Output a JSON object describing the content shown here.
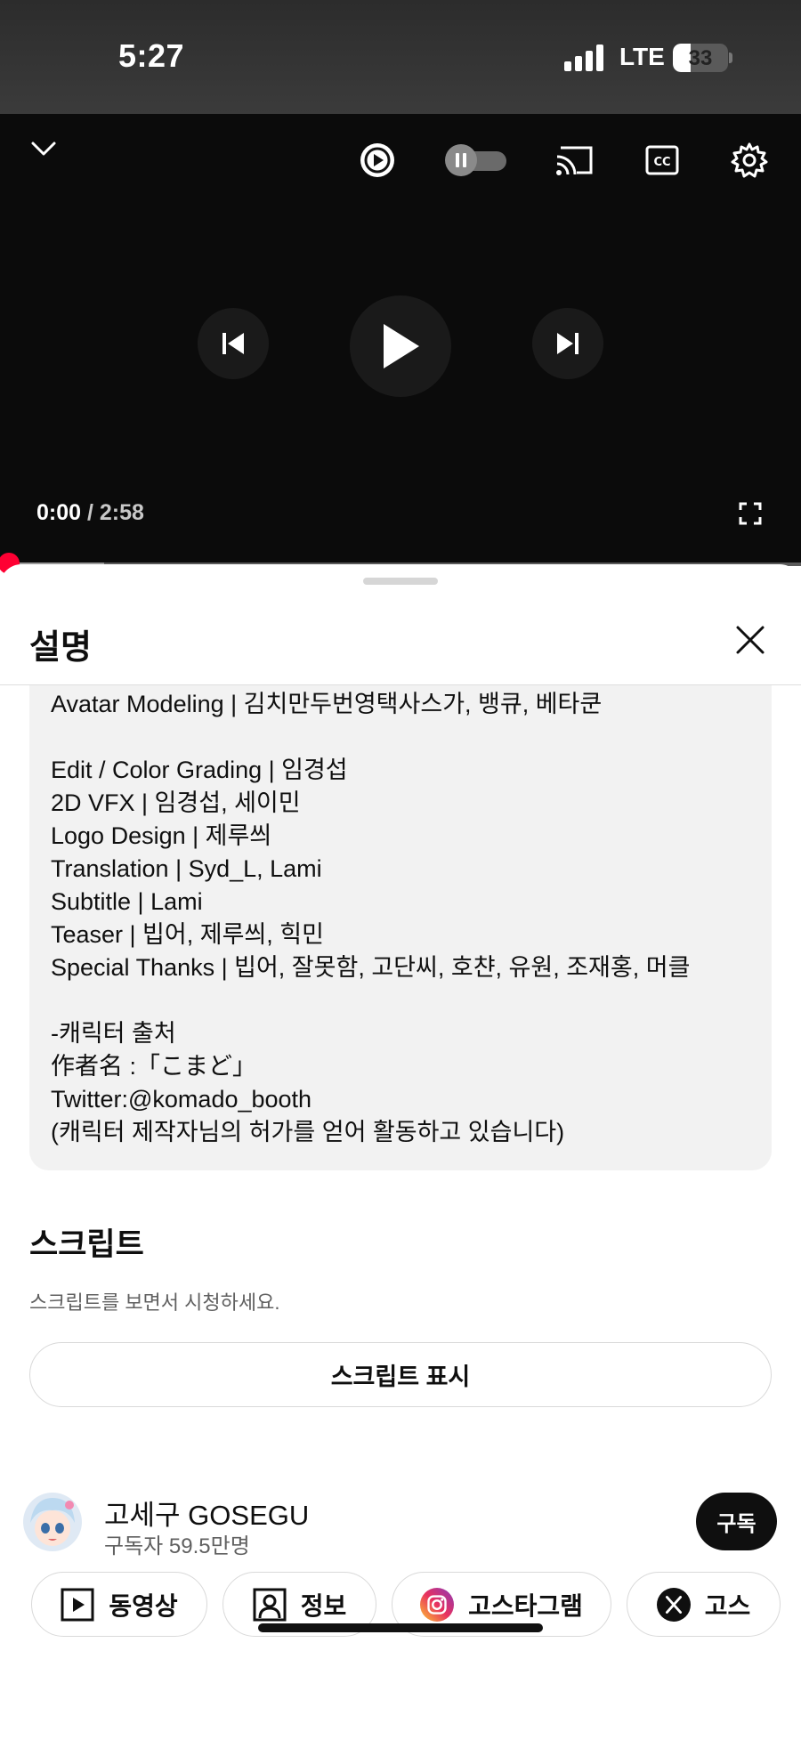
{
  "status_bar": {
    "time": "5:27",
    "network": "LTE",
    "battery": "33",
    "battery_level": 0.33
  },
  "player": {
    "current_time": "0:00",
    "separator": " / ",
    "duration": "2:58",
    "progress": 0.0,
    "buffered": 0.13,
    "icons": [
      "chevron-down-icon",
      "autoplay-icon",
      "autoplay-toggle",
      "cast-icon",
      "captions-icon",
      "settings-icon",
      "previous-icon",
      "play-icon",
      "next-icon",
      "fullscreen-icon"
    ]
  },
  "sheet": {
    "title": "설명",
    "description_lines": [
      "Avatar Modeling | 김치만두번영택사스가, 뱅큐, 베타쿤",
      "",
      "Edit / Color Grading | 임경섭",
      "2D VFX | 임경섭, 세이민",
      "Logo Design | 제루씌",
      "Translation | Syd_L, Lami",
      "Subtitle | Lami",
      "Teaser | 빕어, 제루씌, 힉민",
      "Special Thanks | 빕어, 잘못함, 고단씨, 호챤, 유원, 조재홍, 머클",
      "",
      "-캐릭터 출처",
      "作者名 :「こまど」",
      "Twitter:@komado_booth",
      "(캐릭터 제작자님의 허가를 얻어 활동하고 있습니다)"
    ],
    "script": {
      "title": "스크립트",
      "subtitle": "스크립트를 보면서 시청하세요.",
      "button_label": "스크립트 표시"
    },
    "channel": {
      "name": "고세구 GOSEGU",
      "subscribers": "구독자 59.5만명",
      "subscribe_label": "구독"
    },
    "chips": [
      {
        "label": "동영상",
        "icon": "play-square-icon"
      },
      {
        "label": "정보",
        "icon": "person-square-icon"
      },
      {
        "label": "고스타그램",
        "icon": "instagram-icon"
      },
      {
        "label": "고스",
        "icon": "x-logo-icon"
      }
    ]
  },
  "colors": {
    "accent": "#ff0033",
    "subscribe_bg": "#0f0f0f",
    "description_bg": "#f2f2f2"
  }
}
